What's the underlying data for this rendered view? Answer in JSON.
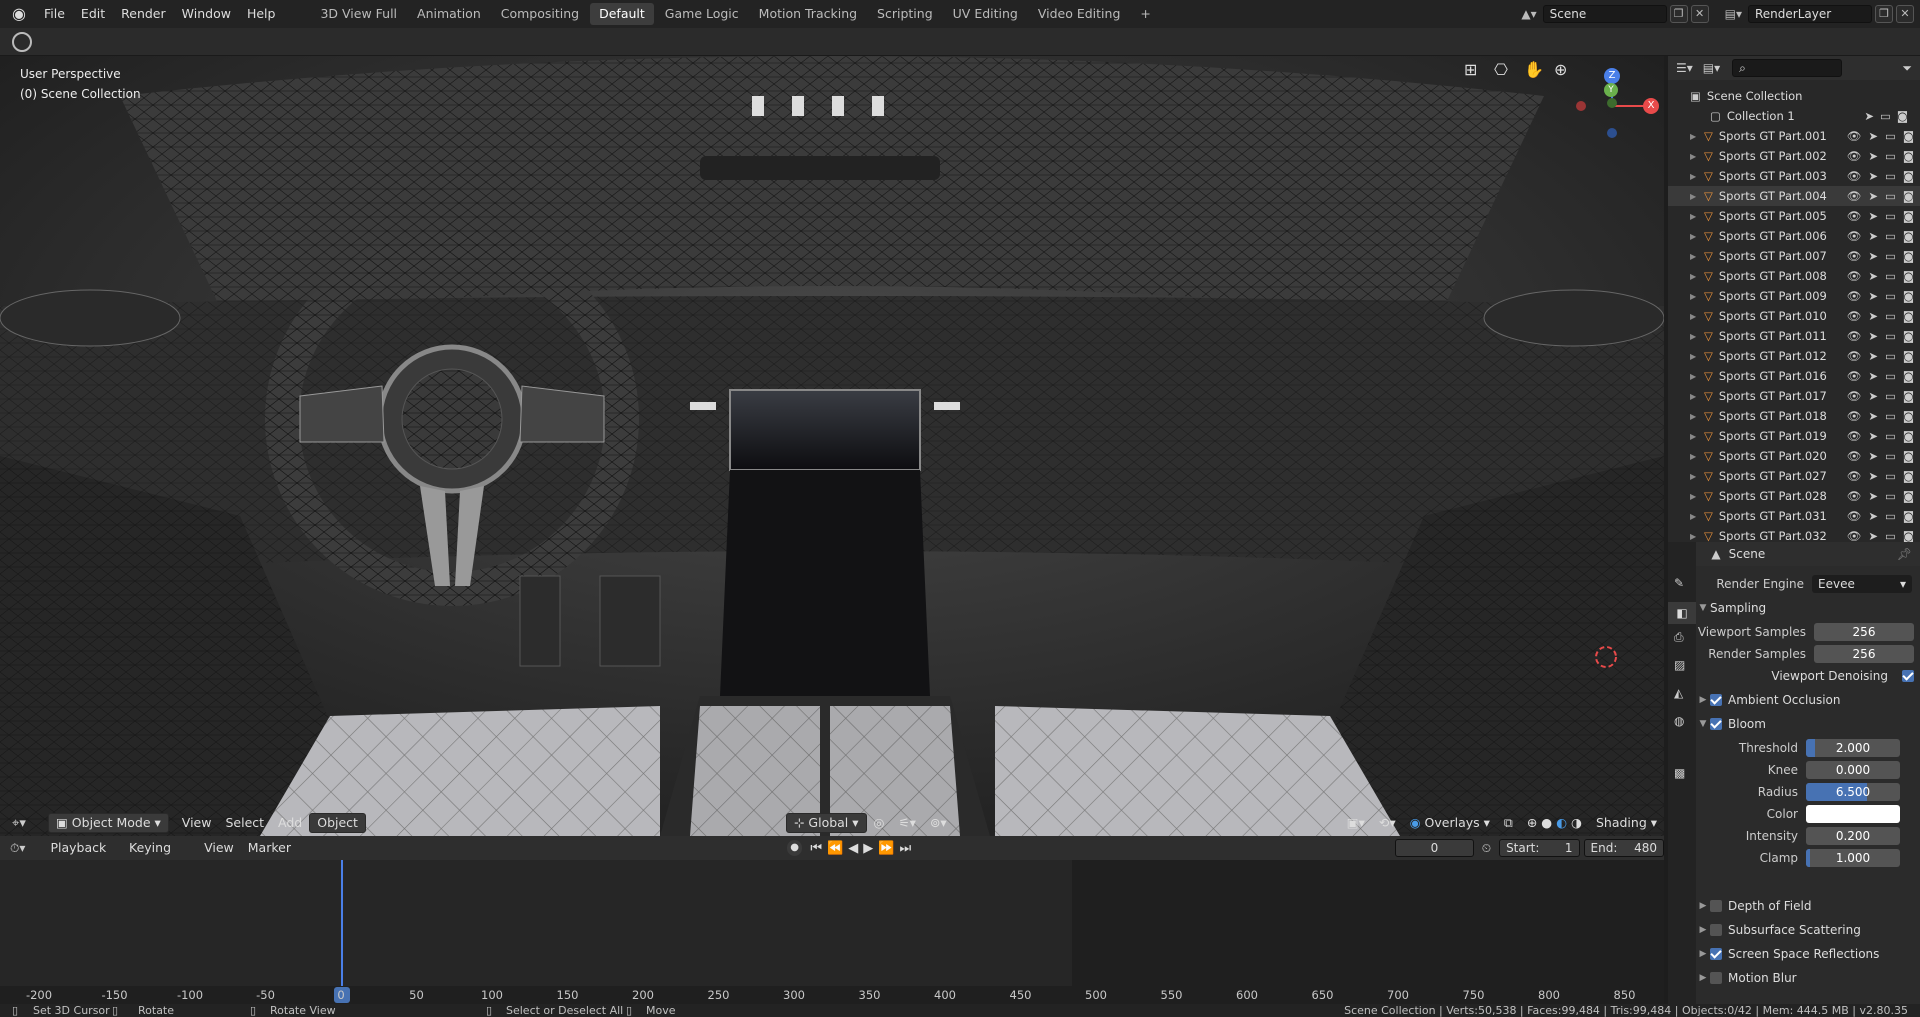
{
  "topbar": {
    "menus": [
      "File",
      "Edit",
      "Render",
      "Window",
      "Help"
    ],
    "workspaces": [
      "3D View Full",
      "Animation",
      "Compositing",
      "Default",
      "Game Logic",
      "Motion Tracking",
      "Scripting",
      "UV Editing",
      "Video Editing"
    ],
    "active_workspace": "Default",
    "add_tab": "+",
    "scene_name": "Scene",
    "view_layer": "RenderLayer"
  },
  "viewport": {
    "perspective": "User Perspective",
    "collection": "(0) Scene Collection",
    "mode": "Object Mode",
    "menus": [
      "View",
      "Select",
      "Add",
      "Object"
    ],
    "transform_orientation": "Global",
    "overlays": "Overlays",
    "shading": "Shading",
    "gizmo": {
      "z": "Z",
      "y": "Y",
      "x": "X"
    }
  },
  "timeline": {
    "menus": [
      "Playback",
      "Keying",
      "View",
      "Marker"
    ],
    "current_frame": "0",
    "start_label": "Start:",
    "start": "1",
    "end_label": "End:",
    "end": "480",
    "ticks": [
      "-200",
      "-150",
      "-100",
      "-50",
      "0",
      "50",
      "100",
      "150",
      "200",
      "250",
      "300",
      "350",
      "400",
      "450",
      "500",
      "550",
      "600",
      "650",
      "700",
      "750",
      "800",
      "850"
    ]
  },
  "outliner": {
    "root": "Scene Collection",
    "collection": "Collection 1",
    "items": [
      "Sports GT Part.001",
      "Sports GT Part.002",
      "Sports GT Part.003",
      "Sports GT Part.004",
      "Sports GT Part.005",
      "Sports GT Part.006",
      "Sports GT Part.007",
      "Sports GT Part.008",
      "Sports GT Part.009",
      "Sports GT Part.010",
      "Sports GT Part.011",
      "Sports GT Part.012",
      "Sports GT Part.016",
      "Sports GT Part.017",
      "Sports GT Part.018",
      "Sports GT Part.019",
      "Sports GT Part.020",
      "Sports GT Part.027",
      "Sports GT Part.028",
      "Sports GT Part.031",
      "Sports GT Part.032"
    ],
    "selected": "Sports GT Part.004"
  },
  "properties": {
    "context": "Scene",
    "render_engine_label": "Render Engine",
    "render_engine": "Eevee",
    "sampling": "Sampling",
    "viewport_samples_label": "Viewport Samples",
    "viewport_samples": "256",
    "render_samples_label": "Render Samples",
    "render_samples": "256",
    "viewport_denoising": "Viewport Denoising",
    "ambient_occlusion": "Ambient Occlusion",
    "bloom": "Bloom",
    "bloom_fields": [
      {
        "label": "Threshold",
        "value": "2.000",
        "fill": 0.1
      },
      {
        "label": "Knee",
        "value": "0.000",
        "fill": 0
      },
      {
        "label": "Radius",
        "value": "6.500",
        "fill": 0.65
      },
      {
        "label": "Color",
        "value": ""
      },
      {
        "label": "Intensity",
        "value": "0.200",
        "fill": 0
      },
      {
        "label": "Clamp",
        "value": "1.000",
        "fill": 0.04
      }
    ],
    "depth_of_field": "Depth of Field",
    "subsurface_scattering": "Subsurface Scattering",
    "screen_space_reflections": "Screen Space Reflections",
    "motion_blur": "Motion Blur"
  },
  "status": {
    "hint1": "Set 3D Cursor",
    "hint2": "Rotate",
    "hint3": "Rotate View",
    "hint4": "Select or Deselect All",
    "hint5": "Move",
    "stats": "Scene Collection | Verts:50,538 | Faces:99,484 | Tris:99,484 | Objects:0/42 | Mem: 444.5 MB | v2.80.35"
  },
  "colors": {
    "accent": "#4772b3",
    "object_icon": "#e8913b",
    "x_axis": "#e84a4a",
    "y_axis": "#6ab04c",
    "z_axis": "#4a7fe8"
  }
}
